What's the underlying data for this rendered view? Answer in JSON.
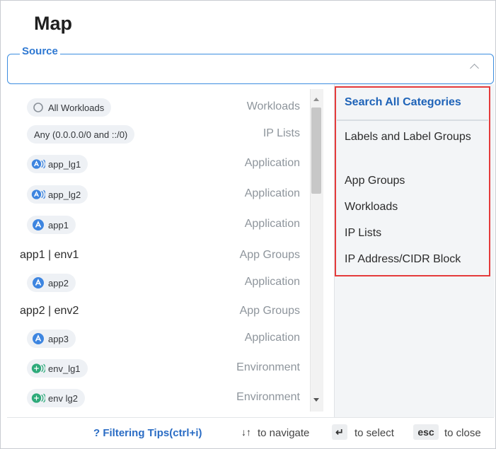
{
  "page": {
    "title": "Map"
  },
  "source": {
    "legend": "Source",
    "value": ""
  },
  "list_items": [
    {
      "label": "All Workloads",
      "category": "Workloads",
      "style": "pill",
      "icon": "circle-icon"
    },
    {
      "label": "Any (0.0.0.0/0 and ::/0)",
      "category": "IP Lists",
      "style": "pill",
      "icon": ""
    },
    {
      "label": "app_lg1",
      "category": "Application",
      "style": "pill",
      "icon": "app-label-group-icon"
    },
    {
      "label": "app_lg2",
      "category": "Application",
      "style": "pill",
      "icon": "app-label-group-icon"
    },
    {
      "label": "app1",
      "category": "Application",
      "style": "pill",
      "icon": "app-label-icon"
    },
    {
      "label": "app1 | env1",
      "category": "App Groups",
      "style": "plain",
      "icon": ""
    },
    {
      "label": "app2",
      "category": "Application",
      "style": "pill",
      "icon": "app-label-icon"
    },
    {
      "label": "app2 | env2",
      "category": "App Groups",
      "style": "plain",
      "icon": ""
    },
    {
      "label": "app3",
      "category": "Application",
      "style": "pill",
      "icon": "app-label-icon"
    },
    {
      "label": "env_lg1",
      "category": "Environment",
      "style": "pill",
      "icon": "env-label-group-icon"
    },
    {
      "label": "env lg2",
      "category": "Environment",
      "style": "pill",
      "icon": "env-label-group-icon"
    }
  ],
  "categories": {
    "header": "Search All Categories",
    "items": [
      "Labels and Label Groups",
      "App Groups",
      "Workloads",
      "IP Lists",
      "IP Address/CIDR Block"
    ]
  },
  "footer": {
    "filtering_tips": "? Filtering Tips(ctrl+i)",
    "navigate_key": "↓↑",
    "navigate_text": "to navigate",
    "select_key": "↵",
    "select_text": "to select",
    "close_key": "esc",
    "close_text": "to close"
  },
  "colors": {
    "accent": "#2e78d2",
    "app_blue": "#3d85e0",
    "env_green": "#2eaa7a",
    "highlight_red": "#e53b3b"
  }
}
